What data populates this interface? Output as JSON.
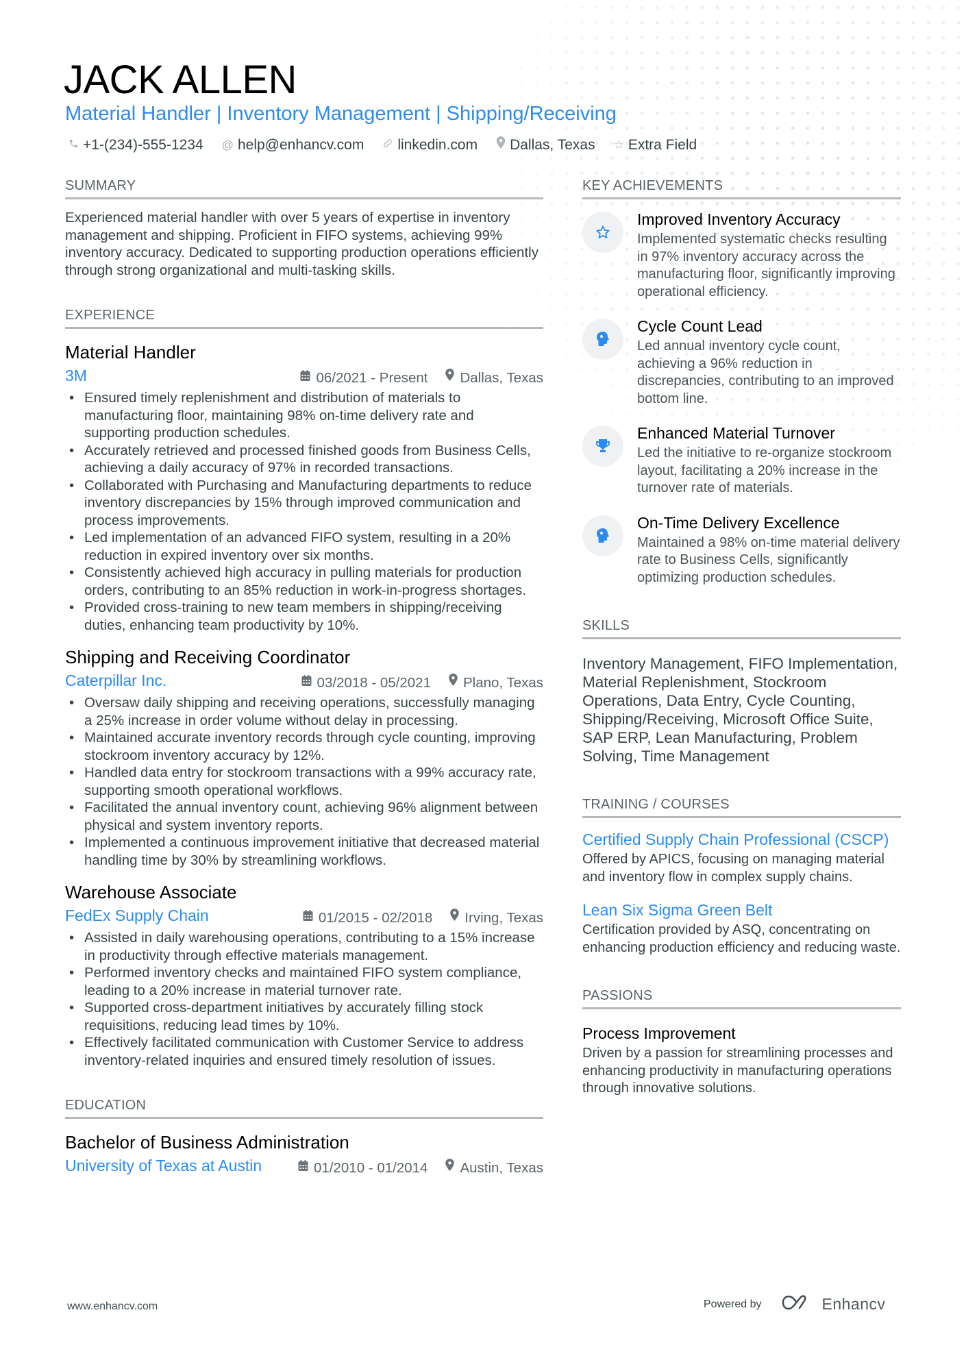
{
  "header": {
    "name": "JACK ALLEN",
    "headline": "Material Handler | Inventory Management | Shipping/Receiving",
    "contacts": [
      {
        "icon": "phone-icon",
        "glyph": "✆",
        "text": "+1-(234)-555-1234"
      },
      {
        "icon": "at-icon",
        "glyph": "@",
        "text": "help@enhancv.com"
      },
      {
        "icon": "link-icon",
        "glyph": "🔗",
        "text": "linkedin.com"
      },
      {
        "icon": "location-pin-icon",
        "glyph": "●",
        "text": "Dallas, Texas"
      },
      {
        "icon": "star-icon",
        "glyph": "☆",
        "text": "Extra Field"
      }
    ]
  },
  "sections": {
    "summary": "SUMMARY",
    "experience": "EXPERIENCE",
    "education": "EDUCATION",
    "key_achievements": "KEY ACHIEVEMENTS",
    "skills": "SKILLS",
    "training": "TRAINING / COURSES",
    "passions": "PASSIONS"
  },
  "summary": "Experienced material handler with over 5 years of expertise in inventory management and shipping. Proficient in FIFO systems, achieving 99% inventory accuracy. Dedicated to supporting production operations efficiently through strong organizational and multi-tasking skills.",
  "experience": [
    {
      "title": "Material Handler",
      "company": "3M",
      "dates": "06/2021 - Present",
      "location": "Dallas, Texas",
      "bullets": [
        "Ensured timely replenishment and distribution of materials to manufacturing floor, maintaining 98% on-time delivery rate and supporting production schedules.",
        "Accurately retrieved and processed finished goods from Business Cells, achieving a daily accuracy of 97% in recorded transactions.",
        "Collaborated with Purchasing and Manufacturing departments to reduce inventory discrepancies by 15% through improved communication and process improvements.",
        "Led implementation of an advanced FIFO system, resulting in a 20% reduction in expired inventory over six months.",
        "Consistently achieved high accuracy in pulling materials for production orders, contributing to an 85% reduction in work-in-progress shortages.",
        "Provided cross-training to new team members in shipping/receiving duties, enhancing team productivity by 10%."
      ]
    },
    {
      "title": "Shipping and Receiving Coordinator",
      "company": "Caterpillar Inc.",
      "dates": "03/2018 - 05/2021",
      "location": "Plano, Texas",
      "bullets": [
        "Oversaw daily shipping and receiving operations, successfully managing a 25% increase in order volume without delay in processing.",
        "Maintained accurate inventory records through cycle counting, improving stockroom inventory accuracy by 12%.",
        "Handled data entry for stockroom transactions with a 99% accuracy rate, supporting smooth operational workflows.",
        "Facilitated the annual inventory count, achieving 96% alignment between physical and system inventory reports.",
        "Implemented a continuous improvement initiative that decreased material handling time by 30% by streamlining workflows."
      ]
    },
    {
      "title": "Warehouse Associate",
      "company": "FedEx Supply Chain",
      "dates": "01/2015 - 02/2018",
      "location": "Irving, Texas",
      "bullets": [
        "Assisted in daily warehousing operations, contributing to a 15% increase in productivity through effective materials management.",
        "Performed inventory checks and maintained FIFO system compliance, leading to a 20% increase in material turnover rate.",
        "Supported cross-department initiatives by accurately filling stock requisitions, reducing lead times by 10%.",
        "Effectively facilitated communication with Customer Service to address inventory-related inquiries and ensured timely resolution of issues."
      ]
    }
  ],
  "education": {
    "degree": "Bachelor of Business Administration",
    "school": "University of Texas at Austin",
    "dates": "01/2010 - 01/2014",
    "location": "Austin, Texas"
  },
  "key_achievements": [
    {
      "icon": "star-icon",
      "title": "Improved Inventory Accuracy",
      "description": "Implemented systematic checks resulting in 97% inventory accuracy across the manufacturing floor, significantly improving operational efficiency."
    },
    {
      "icon": "brain-head-icon",
      "title": "Cycle Count Lead",
      "description": "Led annual inventory cycle count, achieving a 96% reduction in discrepancies, contributing to an improved bottom line."
    },
    {
      "icon": "trophy-icon",
      "title": "Enhanced Material Turnover",
      "description": "Led the initiative to re-organize stockroom layout, facilitating a 20% increase in the turnover rate of materials."
    },
    {
      "icon": "brain-head-icon",
      "title": "On-Time Delivery Excellence",
      "description": "Maintained a 98% on-time material delivery rate to Business Cells, significantly optimizing production schedules."
    }
  ],
  "skills": "Inventory Management, FIFO Implementation, Material Replenishment, Stockroom Operations, Data Entry, Cycle Counting, Shipping/Receiving, Microsoft Office Suite, SAP ERP, Lean Manufacturing, Problem Solving, Time Management",
  "training": [
    {
      "title": "Certified Supply Chain Professional (CSCP)",
      "description": "Offered by APICS, focusing on managing material and inventory flow in complex supply chains."
    },
    {
      "title": "Lean Six Sigma Green Belt",
      "description": "Certification provided by ASQ, concentrating on enhancing production efficiency and reducing waste."
    }
  ],
  "passions": [
    {
      "title": "Process Improvement",
      "description": "Driven by a passion for streamlining processes and enhancing productivity in manufacturing operations through innovative solutions."
    }
  ],
  "footer": {
    "website": "www.enhancv.com",
    "powered_by": "Powered by",
    "brand": "Enhancv"
  },
  "colors": {
    "accent": "#2a8cf0",
    "text": "#384347",
    "rule": "#b4b8bb"
  }
}
